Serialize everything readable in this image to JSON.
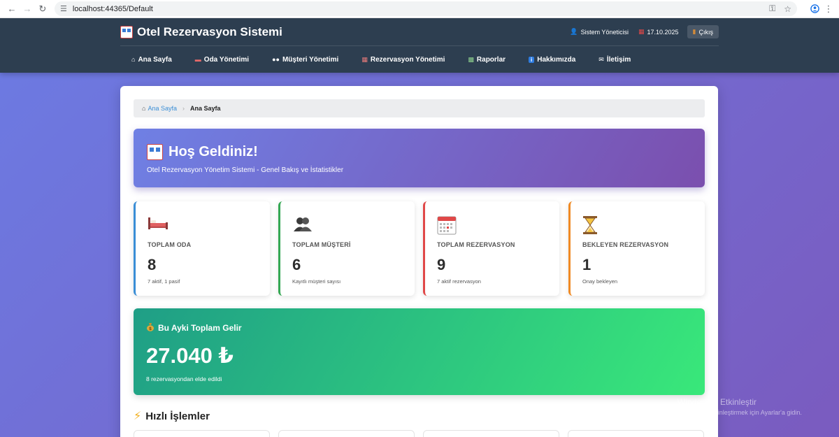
{
  "browser": {
    "url": "localhost:44365/Default"
  },
  "header": {
    "app_title": "Otel Rezervasyon Sistemi",
    "user": "Sistem Yöneticisi",
    "date": "17.10.2025",
    "logout_label": "Çıkış"
  },
  "nav": {
    "items": [
      {
        "label": "Ana Sayfa",
        "icon": "house-icon"
      },
      {
        "label": "Oda Yönetimi",
        "icon": "bed-icon"
      },
      {
        "label": "Müşteri Yönetimi",
        "icon": "users-icon"
      },
      {
        "label": "Rezervasyon Yönetimi",
        "icon": "calendar-icon"
      },
      {
        "label": "Raporlar",
        "icon": "chart-icon"
      },
      {
        "label": "Hakkımızda",
        "icon": "info-icon"
      },
      {
        "label": "İletişim",
        "icon": "envelope-icon"
      }
    ]
  },
  "breadcrumb": {
    "home": "Ana Sayfa",
    "current": "Ana Sayfa"
  },
  "welcome": {
    "title": "Hoş Geldiniz!",
    "subtitle": "Otel Rezervasyon Yönetim Sistemi - Genel Bakış ve İstatistikler"
  },
  "stats": [
    {
      "label": "TOPLAM ODA",
      "value": "8",
      "note": "7 aktif, 1 pasif",
      "icon": "bed-icon",
      "color": "#3a8ed6"
    },
    {
      "label": "TOPLAM MÜŞTERİ",
      "value": "6",
      "note": "Kayıtlı müşteri sayısı",
      "icon": "users-icon",
      "color": "#34a853"
    },
    {
      "label": "TOPLAM REZERVASYON",
      "value": "9",
      "note": "7 aktif rezervasyon",
      "icon": "calendar-icon",
      "color": "#e04848"
    },
    {
      "label": "BEKLEYEN REZERVASYON",
      "value": "1",
      "note": "Onay bekleyen",
      "icon": "hourglass-icon",
      "color": "#f08a24"
    }
  ],
  "income": {
    "title": "Bu Ayki Toplam Gelir",
    "amount": "27.040 ₺",
    "note": "8 rezervasyondan elde edildi"
  },
  "quick_actions": {
    "title": "Hızlı İşlemler"
  },
  "watermark": {
    "line1": "Windows'u Etkinleştir",
    "line2": "Windows'u etkinleştirmek için Ayarlar'a gidin."
  }
}
